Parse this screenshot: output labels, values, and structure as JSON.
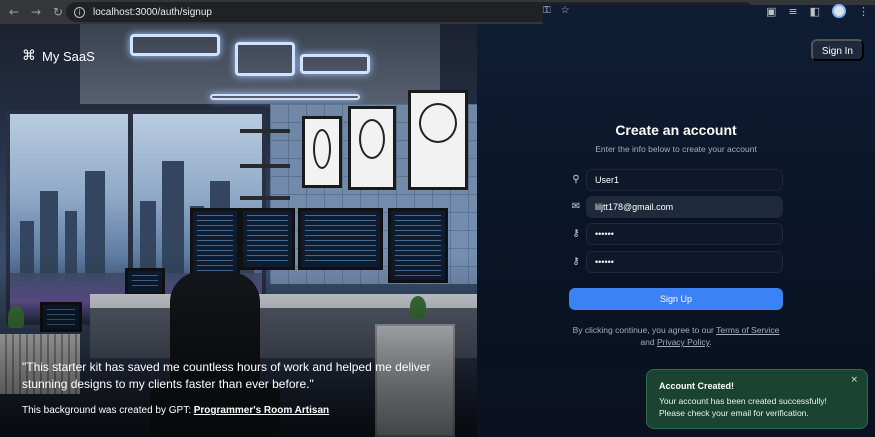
{
  "browser": {
    "url": "localhost:3000/auth/signup",
    "icons": [
      "back-arrow-icon",
      "forward-arrow-icon",
      "reload-icon",
      "info-icon",
      "password-key-icon",
      "bookmark-star-icon",
      "extensions-icon",
      "media-icon",
      "sidebar-icon",
      "profile-avatar",
      "menu-dots-icon"
    ]
  },
  "brand": {
    "icon": "⌘",
    "name": "My SaaS"
  },
  "hero": {
    "quote": "\"This starter kit has saved me countless hours of work and helped me deliver stunning designs to my clients faster than ever before.\"",
    "credit_prefix": "This background was created by GPT: ",
    "credit_link": "Programmer's Room Artisan"
  },
  "header": {
    "signin_label": "Sign In"
  },
  "form": {
    "title": "Create an account",
    "subtitle": "Enter the info below to create your account",
    "name_value": "User1",
    "email_value": "liljtt178@gmail.com",
    "password_value": "••••••",
    "confirm_value": "••••••",
    "submit_label": "Sign Up",
    "terms_prefix": "By clicking continue, you agree to our ",
    "terms_link": "Terms of Service",
    "terms_and": " and ",
    "privacy_link": "Privacy Policy",
    "terms_suffix": "."
  },
  "toast": {
    "title": "Account Created!",
    "message": "Your account has been created successfully! Please check your email for verification.",
    "close": "×"
  },
  "colors": {
    "accent": "#3b82f6",
    "toast_bg": "#1b4332",
    "panel_bg": "#0a1426"
  }
}
